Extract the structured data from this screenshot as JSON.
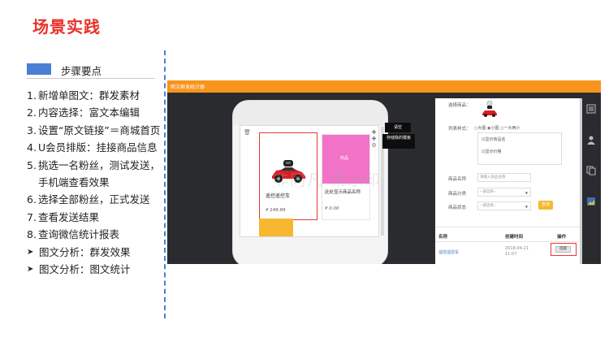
{
  "page": {
    "title": "场景实践"
  },
  "steps_section": {
    "header": "步骤要点",
    "accent_color": "#4a7fd4",
    "items": [
      {
        "marker": "1.",
        "text": "新增单图文：群发素材"
      },
      {
        "marker": "2.",
        "text": "内容选择：富文本编辑"
      },
      {
        "marker": "3.",
        "text": "设置“原文链接”＝商城首页"
      },
      {
        "marker": "4.",
        "text": "U会员排版：挂接商品信息"
      },
      {
        "marker": "5.",
        "text": "挑选一名粉丝，测试发送，手机端查看效果"
      },
      {
        "marker": "6.",
        "text": "选择全部粉丝，正式发送"
      },
      {
        "marker": "7.",
        "text": "查看发送结果"
      },
      {
        "marker": "8.",
        "text": "查询微信统计报表"
      },
      {
        "marker": "➤",
        "text": "图文分析：群发效果"
      },
      {
        "marker": "➤",
        "text": "图文分析：图文统计"
      }
    ]
  },
  "screenshot": {
    "header_title": "图文群发统计器",
    "header_color": "#f7941d",
    "phone": {
      "watermark": "非同凡·柔水印",
      "product1": {
        "name": "遥控遥控车",
        "price": "¥ 149.99"
      },
      "product2": {
        "image_label": "商品",
        "name": "此处显示商品名称",
        "price": "¥ 0.00"
      },
      "tooltips": [
        "请空",
        "存储我的模板"
      ]
    },
    "panel": {
      "select_product_label": "选择商品：",
      "list_style_label": "列表样式：",
      "list_style_options": [
        "大图",
        "小图",
        "一大两小"
      ],
      "checkboxes": [
        "显示商品名",
        "显示价格"
      ],
      "product_name_label": "商品名称",
      "product_name_placeholder": "请输入商品名称",
      "category_label": "商品分类",
      "category_value": "--请选择--",
      "status_label": "商品状态",
      "status_value": "--请选择--",
      "query_button": "查询",
      "table": {
        "headers": [
          "名称",
          "创建时间",
          "操作"
        ],
        "rows": [
          {
            "name": "遥控遥控车",
            "time_date": "2018-04-21",
            "time_clock": "11:07",
            "action": "选取"
          }
        ]
      }
    }
  },
  "colors": {
    "title_red": "#e8322b",
    "highlight_red": "#e53935",
    "pink": "#f272c7",
    "yellow": "#f7b731"
  }
}
